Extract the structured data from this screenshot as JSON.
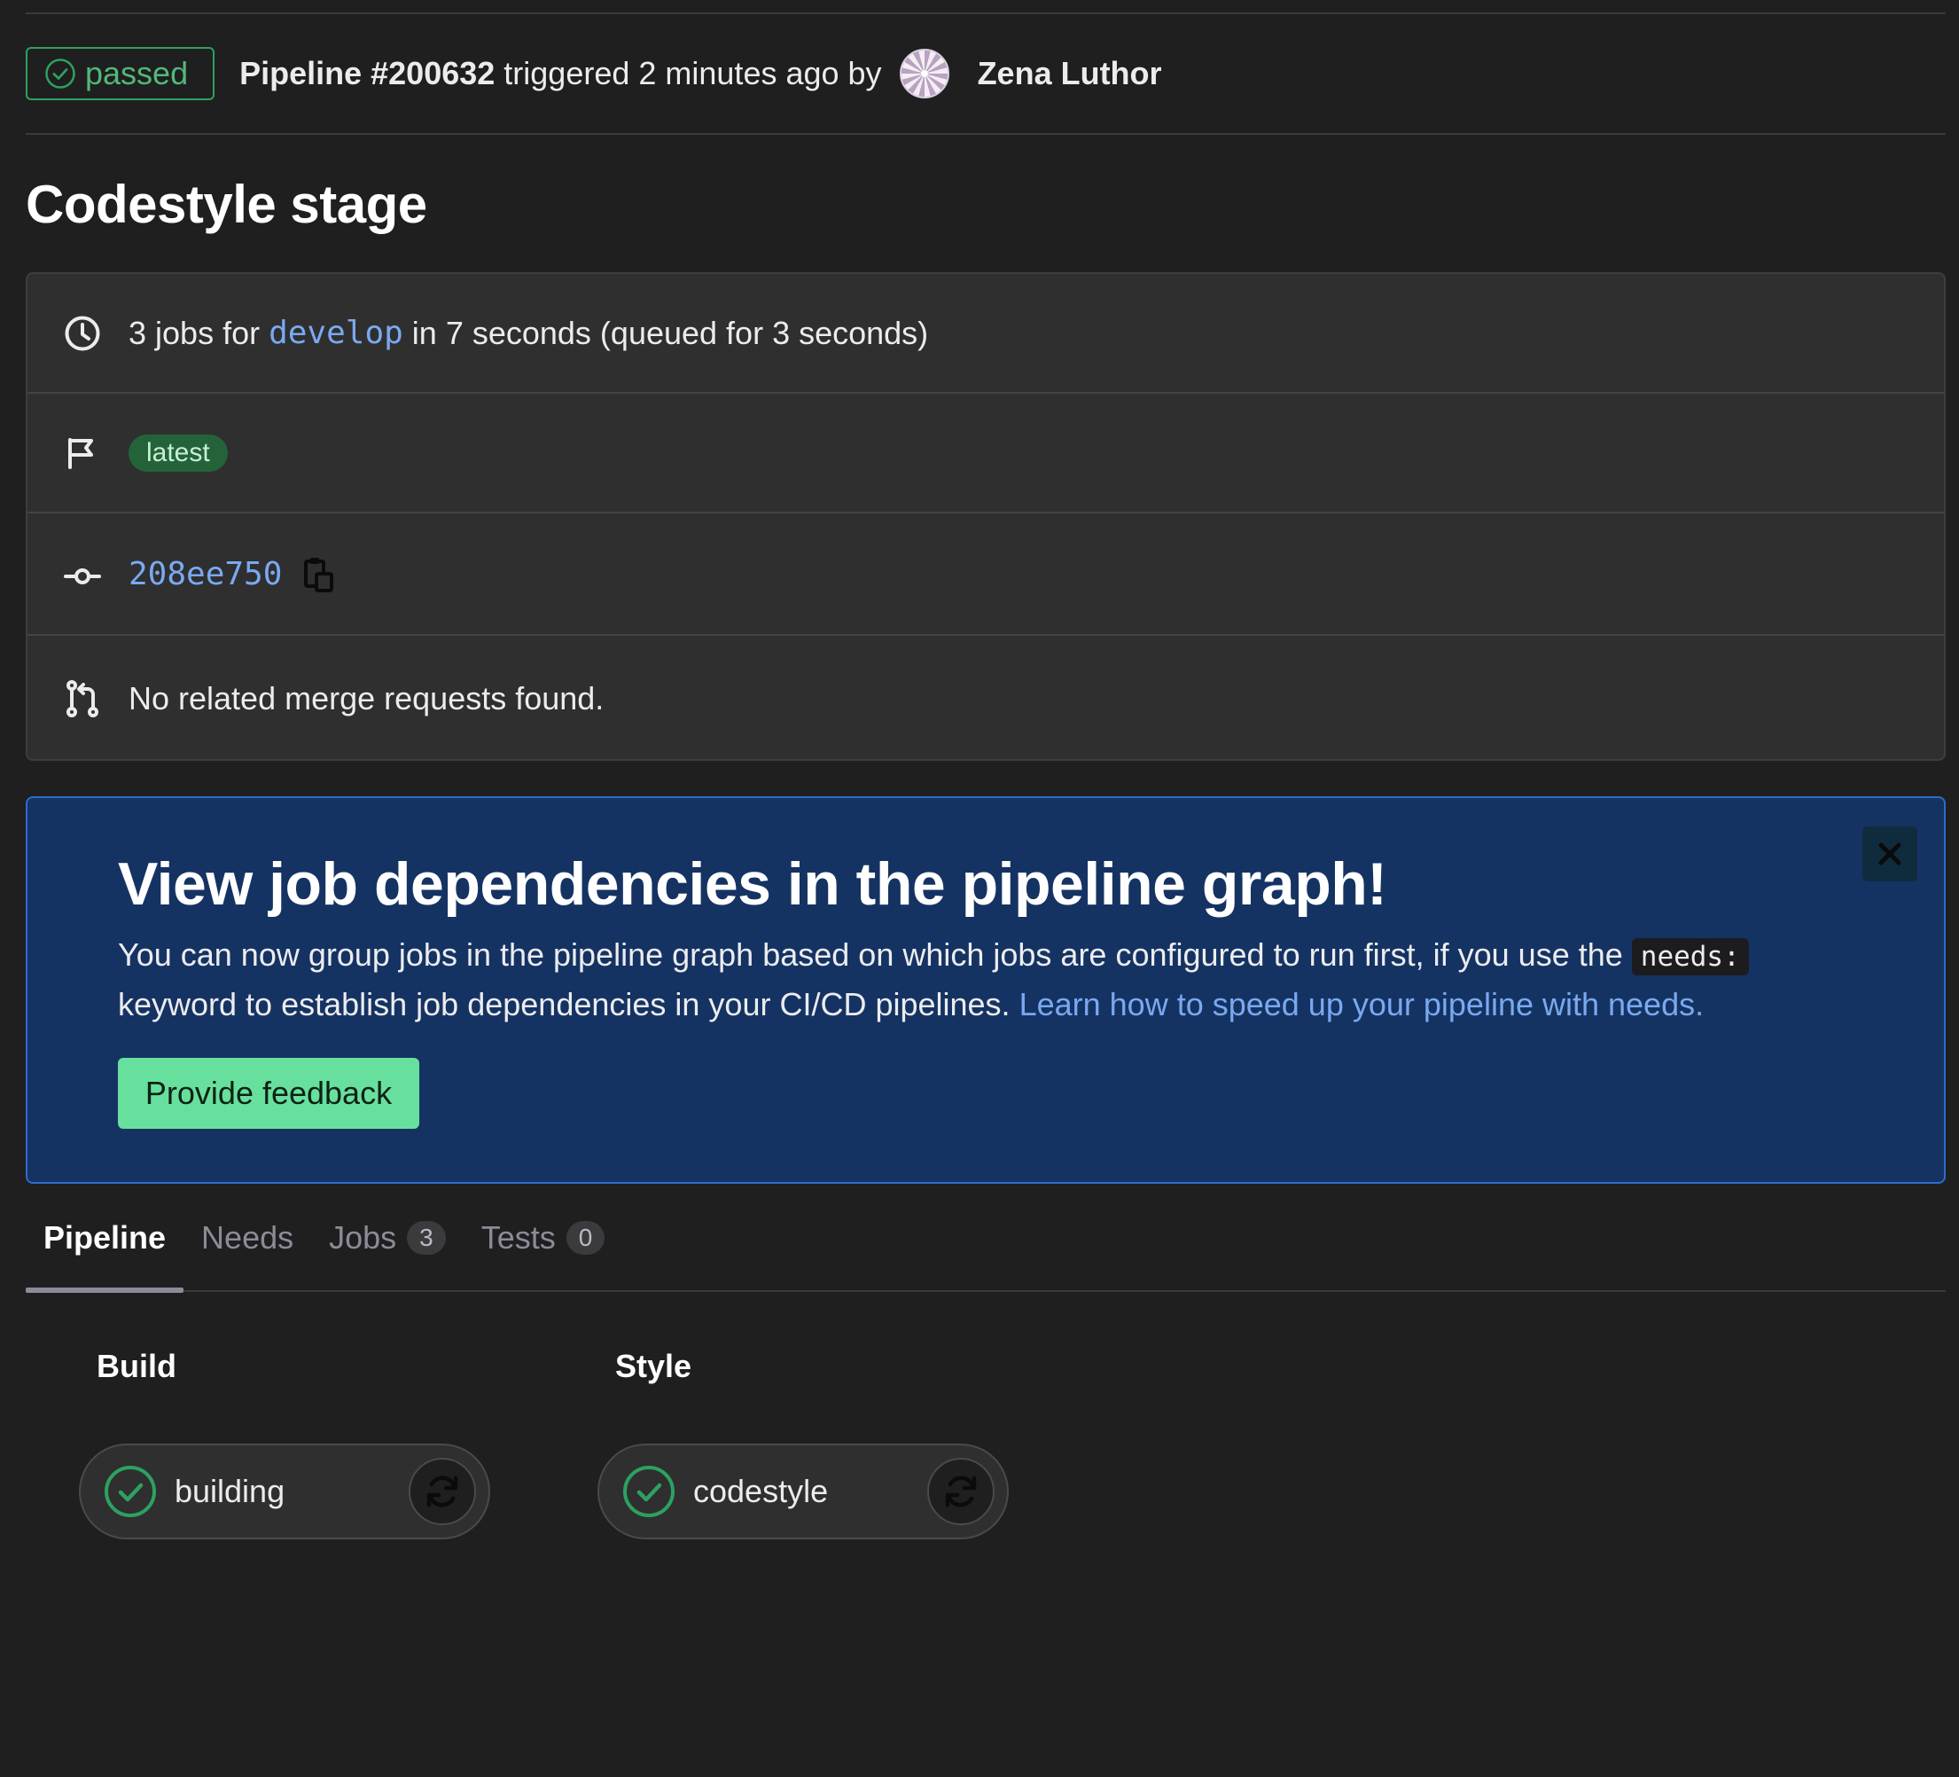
{
  "header": {
    "status": "passed",
    "pipeline_label": "Pipeline #200632",
    "triggered_text": "triggered 2 minutes ago by",
    "user_name": "Zena Luthor"
  },
  "page_title": "Codestyle stage",
  "info": {
    "jobs_prefix": "3 jobs for",
    "branch": "develop",
    "jobs_suffix": "in 7 seconds (queued for 3 seconds)",
    "tag": "latest",
    "commit_sha": "208ee750",
    "merge_requests": "No related merge requests found."
  },
  "banner": {
    "title": "View job dependencies in the pipeline graph!",
    "body_part1": "You can now group jobs in the pipeline graph based on which jobs are configured to run first, if you use the",
    "code": "needs:",
    "body_part2": "keyword to establish job dependencies in your CI/CD pipelines.",
    "link_text": "Learn how to speed up your pipeline with needs.",
    "button_label": "Provide feedback"
  },
  "tabs": [
    {
      "label": "Pipeline",
      "count": null
    },
    {
      "label": "Needs",
      "count": null
    },
    {
      "label": "Jobs",
      "count": "3"
    },
    {
      "label": "Tests",
      "count": "0"
    }
  ],
  "stages": [
    {
      "title": "Build",
      "jobs": [
        {
          "name": "building",
          "status": "success"
        }
      ]
    },
    {
      "title": "Style",
      "jobs": [
        {
          "name": "codestyle",
          "status": "success"
        }
      ]
    }
  ],
  "colors": {
    "background": "#1f1f1f",
    "success": "#2da160",
    "link": "#7aa9f0",
    "banner": "#153362",
    "feedback_button": "#68e09d"
  }
}
